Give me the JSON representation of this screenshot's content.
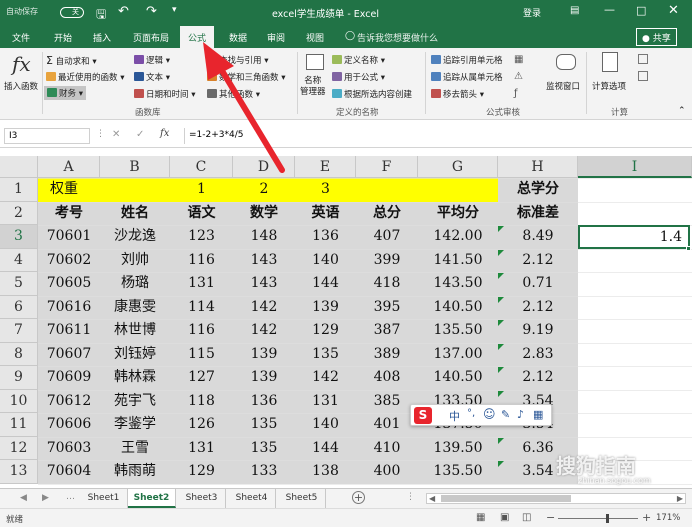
{
  "titlebar": {
    "autosave": "自动保存",
    "autosave_state": "关",
    "title": "excel学生成绩单 - Excel",
    "login": "登录"
  },
  "tabs": [
    "文件",
    "开始",
    "插入",
    "页面布局",
    "公式",
    "数据",
    "审阅",
    "视图"
  ],
  "tell_me": "告诉我您想要做什么",
  "share": "共享",
  "ribbon": {
    "insert_function": "插入函数",
    "autosum": "自动求和",
    "recent": "最近使用的函数",
    "financial": "财务",
    "logical": "逻辑",
    "text": "文本",
    "datetime": "日期和时间",
    "lookup": "查找与引用",
    "math": "数学和三角函数",
    "more": "其他函数",
    "group_library": "函数库",
    "name_manager": "名称\n管理器",
    "define_name": "定义名称",
    "use_in_formula": "用于公式",
    "create_from_sel": "根据所选内容创建",
    "group_names": "定义的名称",
    "trace_precedents": "追踪引用单元格",
    "trace_dependents": "追踪从属单元格",
    "remove_arrows": "移去箭头",
    "group_audit": "公式审核",
    "watch_window": "监视窗口",
    "calc_options": "计算选项",
    "group_calc": "计算"
  },
  "formula_bar": {
    "namebox": "I3",
    "fx": "fx",
    "formula": "=1-2+3*4/5"
  },
  "columns": [
    "A",
    "B",
    "C",
    "D",
    "E",
    "F",
    "G",
    "H",
    "I"
  ],
  "rows": [
    "1",
    "2",
    "3",
    "4",
    "5",
    "6",
    "7",
    "8",
    "9",
    "10",
    "11",
    "12",
    "13"
  ],
  "sheet": {
    "r1": [
      "权重",
      "",
      "1",
      "2",
      "3",
      "",
      "",
      "总学分"
    ],
    "r2": [
      "考号",
      "姓名",
      "语文",
      "数学",
      "英语",
      "总分",
      "平均分",
      "标准差"
    ],
    "data": [
      [
        "70601",
        "沙龙逸",
        "123",
        "148",
        "136",
        "407",
        "142.00",
        "8.49"
      ],
      [
        "70602",
        "刘帅",
        "116",
        "143",
        "140",
        "399",
        "141.50",
        "2.12"
      ],
      [
        "70605",
        "杨璐",
        "131",
        "143",
        "144",
        "418",
        "143.50",
        "0.71"
      ],
      [
        "70616",
        "康惠雯",
        "114",
        "142",
        "139",
        "395",
        "140.50",
        "2.12"
      ],
      [
        "70611",
        "林世博",
        "116",
        "142",
        "129",
        "387",
        "135.50",
        "9.19"
      ],
      [
        "70607",
        "刘钰婷",
        "115",
        "139",
        "135",
        "389",
        "137.00",
        "2.83"
      ],
      [
        "70609",
        "韩林霖",
        "127",
        "139",
        "142",
        "408",
        "140.50",
        "2.12"
      ],
      [
        "70612",
        "苑宇飞",
        "118",
        "136",
        "131",
        "385",
        "133.50",
        "3.54"
      ],
      [
        "70606",
        "李鉴学",
        "126",
        "135",
        "140",
        "401",
        "137.50",
        "3.54"
      ],
      [
        "70603",
        "王雪",
        "131",
        "135",
        "144",
        "410",
        "139.50",
        "6.36"
      ],
      [
        "70604",
        "韩雨萌",
        "129",
        "133",
        "138",
        "400",
        "135.50",
        "3.54"
      ]
    ],
    "i3": "1.4"
  },
  "sheets": [
    "Sheet1",
    "Sheet2",
    "Sheet3",
    "Sheet4",
    "Sheet5"
  ],
  "active_sheet": "Sheet2",
  "status": {
    "ready": "就绪",
    "zoom": "171%"
  },
  "ime": {
    "mode": "中"
  },
  "watermark": "搜狗指南",
  "watermark_url": "zhinan.sogou.com",
  "colors": {
    "excel_green": "#217346",
    "weight_row": "#ffff00",
    "gray_data": "#d9d9d9",
    "arrow": "#e8252d"
  }
}
